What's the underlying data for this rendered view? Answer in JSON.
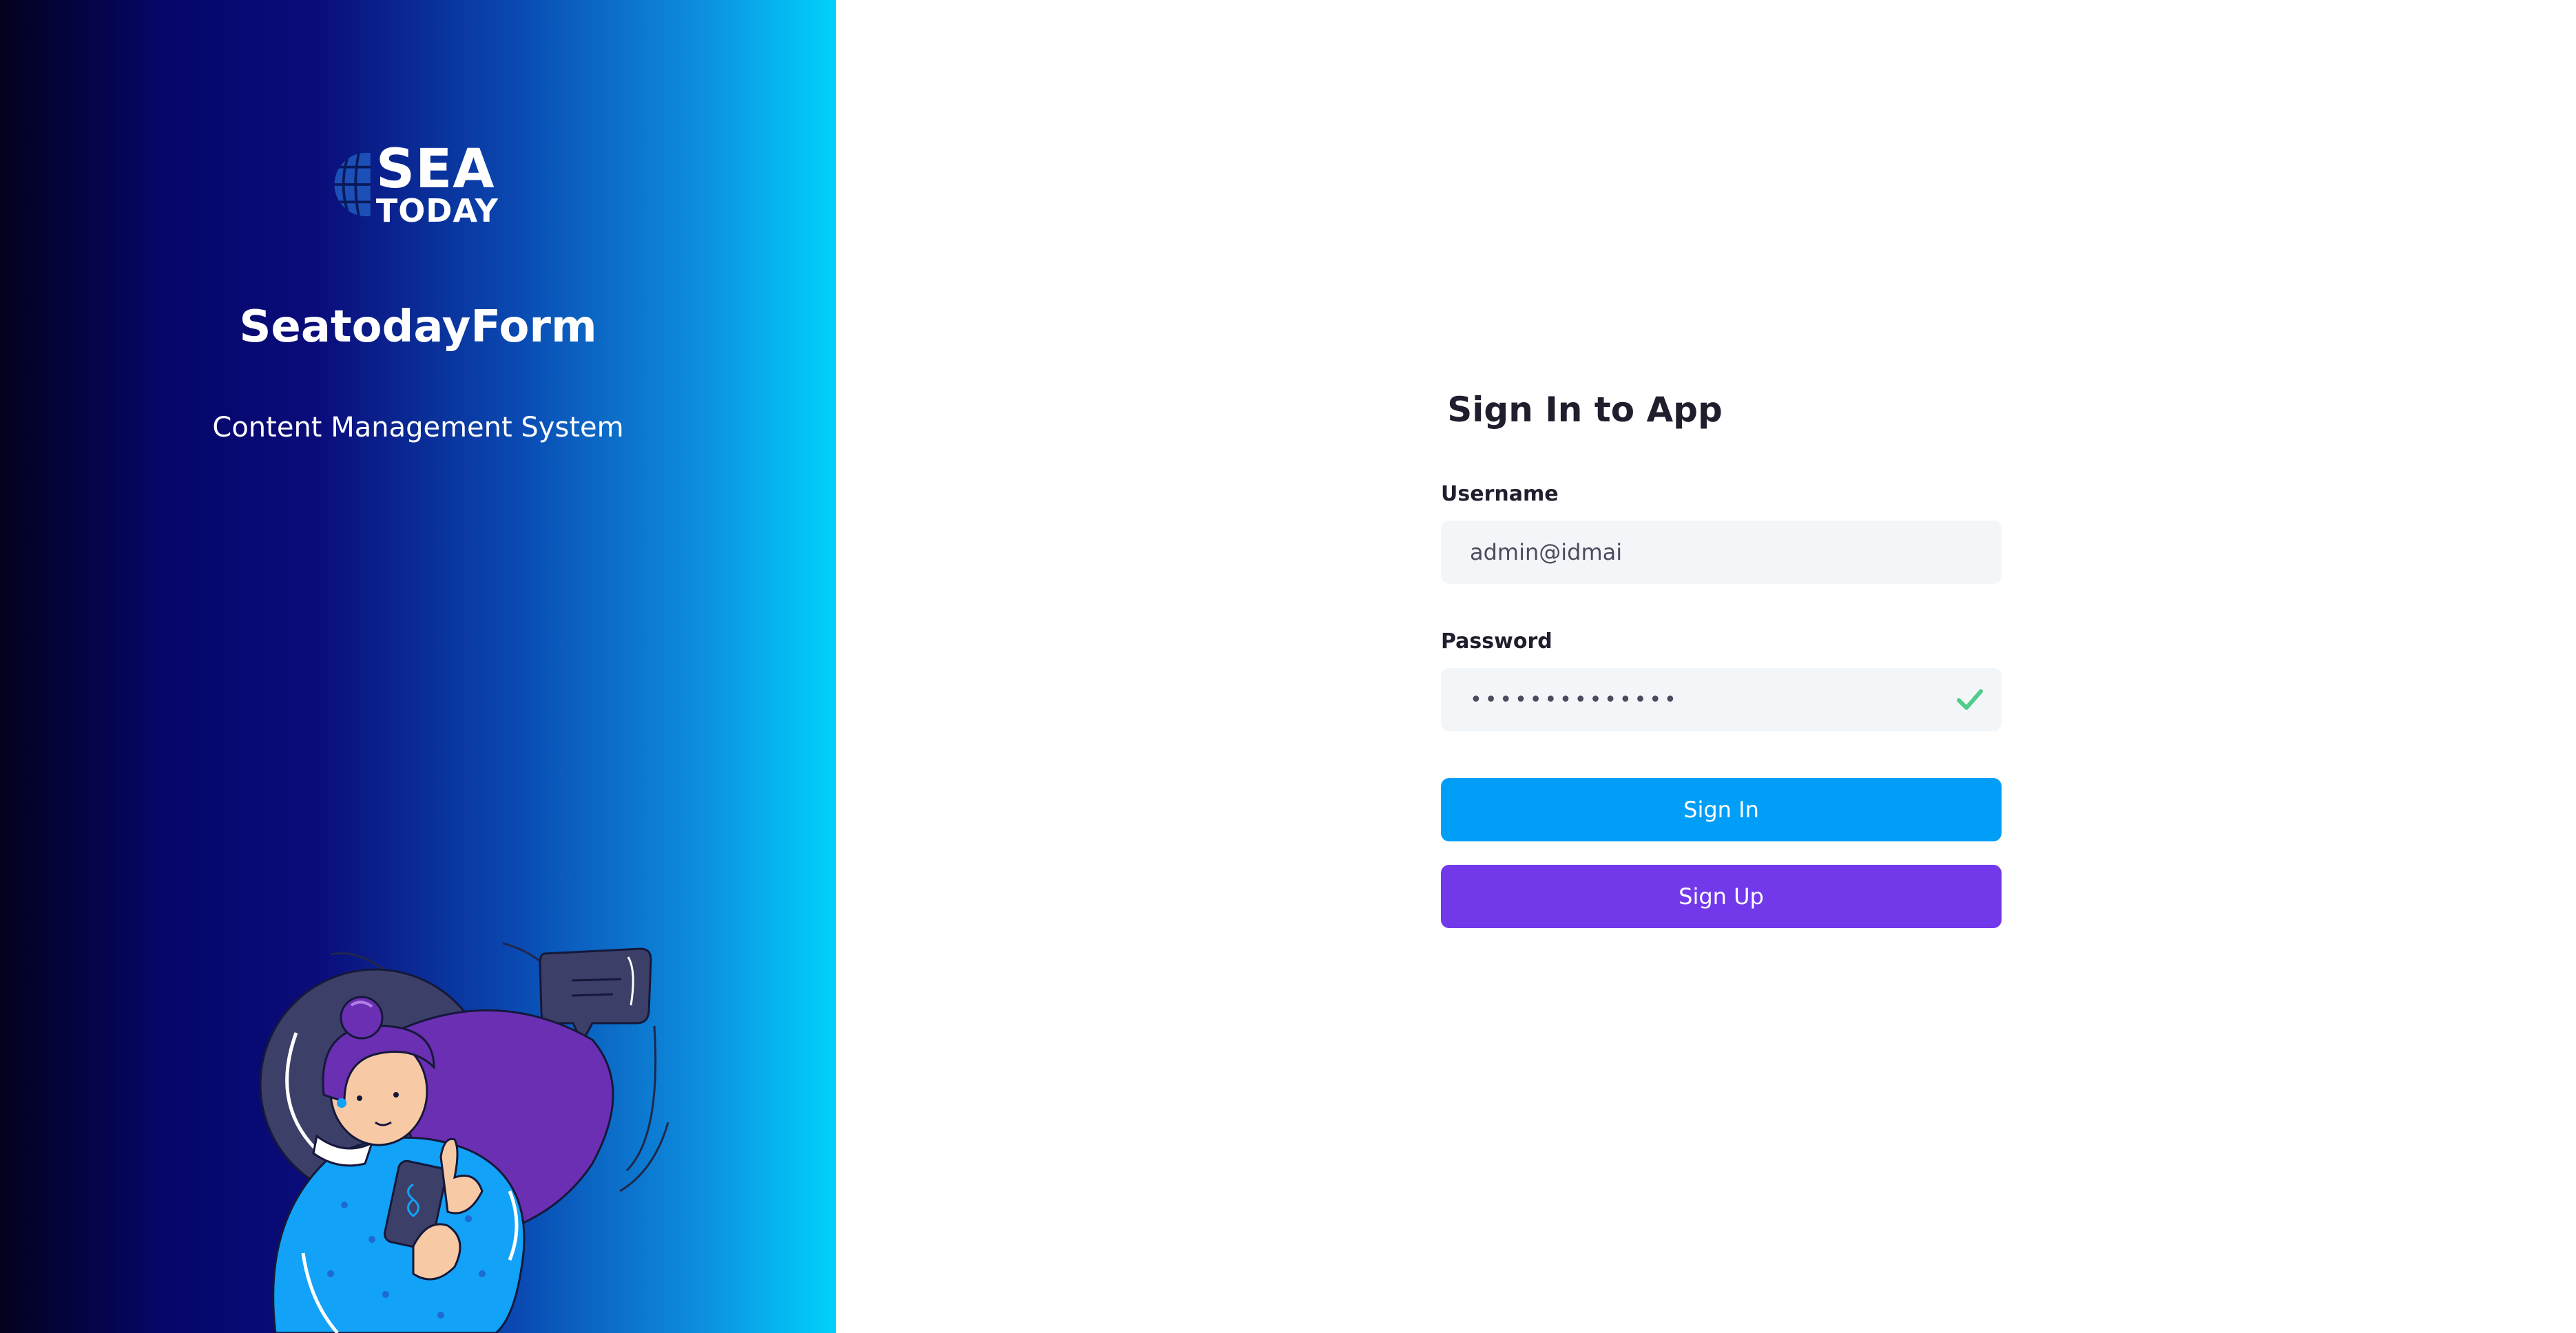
{
  "brand": {
    "logo_word_top": "SEA",
    "logo_word_bottom": "TODAY",
    "app_name": "SeatodayForm",
    "tagline": "Content Management System"
  },
  "form": {
    "title": "Sign In to App",
    "username_label": "Username",
    "username_value": "admin@idmai",
    "password_label": "Password",
    "password_value": "••••••••••••••",
    "sign_in_label": "Sign In",
    "sign_up_label": "Sign Up"
  },
  "icons": {
    "logo": "globe-icon",
    "password_status": "check-icon",
    "illustration": "woman-with-phone-illustration"
  },
  "colors": {
    "primary": "#009ef7",
    "secondary": "#7239ea",
    "valid": "#50cd89",
    "title_text": "#1e1e2d",
    "input_bg": "#f3f6f9"
  }
}
